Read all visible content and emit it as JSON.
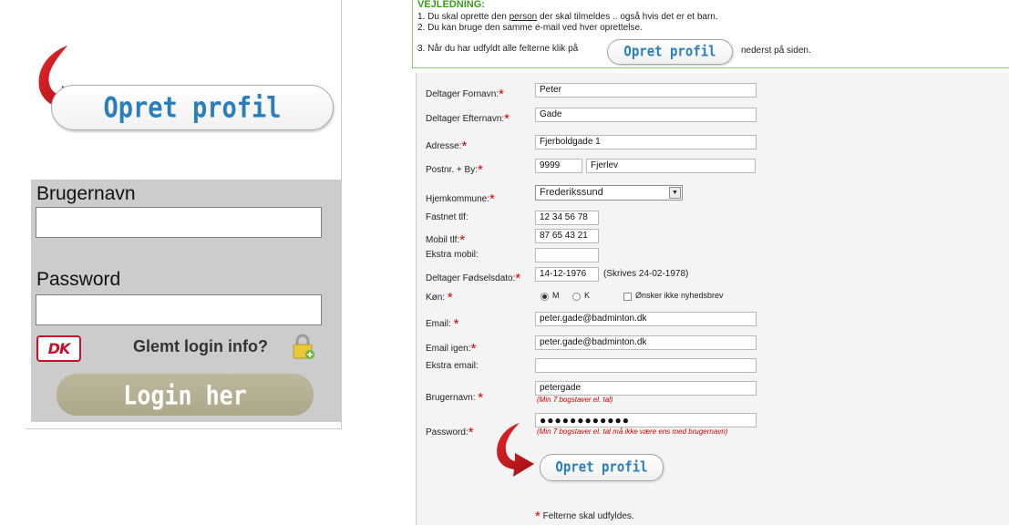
{
  "left": {
    "create_profile_label": "Opret profil",
    "username_label": "Brugernavn",
    "username_value": "",
    "password_label": "Password",
    "password_value": "",
    "dk_logo_text": "DK",
    "forgot_label": "Glemt login info?",
    "login_label": "Login her"
  },
  "guide": {
    "title": "VEJLEDNING:",
    "line1_a": "1. Du skal oprette den ",
    "line1_u": "person",
    "line1_b": " der skal tilmeldes .. også hvis det er et barn.",
    "line2": "2. Du kan bruge den samme e-mail ved hver oprettelse.",
    "line3_a": "3. Når du har udfyldt alle felterne klik på",
    "button_label": "Opret profil",
    "line3_b": "nederst på siden."
  },
  "form": {
    "first_name_label": "Deltager Fornavn:",
    "first_name": "Peter",
    "last_name_label": "Deltager Efternavn:",
    "last_name": "Gade",
    "address_label": "Adresse:",
    "address": "Fjerboldgade 1",
    "zip_city_label": "Postnr. + By:",
    "zip": "9999",
    "city": "Fjerlev",
    "municipality_label": "Hjemkommune:",
    "municipality": "Frederikssund",
    "landline_label": "Fastnet tlf:",
    "landline": "12 34 56 78",
    "mobile_label": "Mobil tlf:",
    "mobile": "87 65 43 21",
    "extra_mobile_label": "Ekstra mobil:",
    "extra_mobile": "",
    "birthdate_label": "Deltager Fødselsdato:",
    "birthdate": "14-12-1976",
    "birthdate_hint": "(Skrives 24-02-1978)",
    "gender_label": "Køn:",
    "gender_m": "M",
    "gender_k": "K",
    "newsletter_label": "Ønsker ikke nyhedsbrev",
    "email_label": "Email:",
    "email": "peter.gade@badminton.dk",
    "email_again_label": "Email igen:",
    "email_again": "peter.gade@badminton.dk",
    "extra_email_label": "Ekstra email:",
    "extra_email": "",
    "username_label": "Brugernavn:",
    "username": "petergade",
    "username_note": "(Min 7 bogstaver el. tal)",
    "password_label": "Password:",
    "password": "●●●●●●●●●●●●",
    "password_note": "(Min 7 bogstaver el. tal må ikke være ens med brugernavn)",
    "submit_label": "Opret profil",
    "footnote": "Felterne skal udfyldes."
  },
  "star": "*",
  "select_arrow": "▼",
  "colors": {
    "accent_blue": "#2a7ebc",
    "required_red": "#d80000",
    "guide_green": "#3c9a1a",
    "arrow_red": "#c0161c",
    "login_button": "#b3ae91"
  }
}
